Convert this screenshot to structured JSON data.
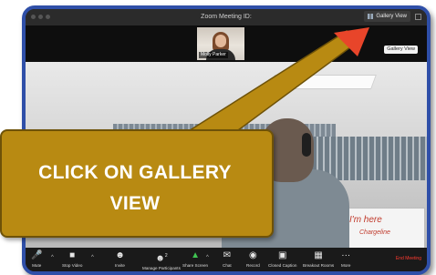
{
  "window": {
    "title": "Zoom Meeting ID:",
    "gallery_view_label": "Gallery View",
    "gallery_view_tooltip": "Gallery View"
  },
  "participant": {
    "name": "Molly Parker"
  },
  "whiteboard": {
    "line1": "Hi! I'm here",
    "line2": "Chargeline"
  },
  "toolbar": {
    "mute_label": "Mute",
    "stop_video_label": "Stop Video",
    "invite_label": "Invite",
    "manage_participants_label": "Manage Participants",
    "participant_count": "2",
    "share_screen_label": "Share Screen",
    "chat_label": "Chat",
    "record_label": "Record",
    "closed_caption_label": "Closed Caption",
    "breakout_rooms_label": "Breakout Rooms",
    "more_label": "More",
    "end_meeting_label": "End Meeting"
  },
  "callout": {
    "line1": "CLICK ON GALLERY",
    "line2": "VIEW"
  },
  "colors": {
    "frame_border": "#2f4fa8",
    "callout_fill": "#b88a12",
    "arrow": "#e8452a",
    "end_meeting": "#ff3b30"
  }
}
